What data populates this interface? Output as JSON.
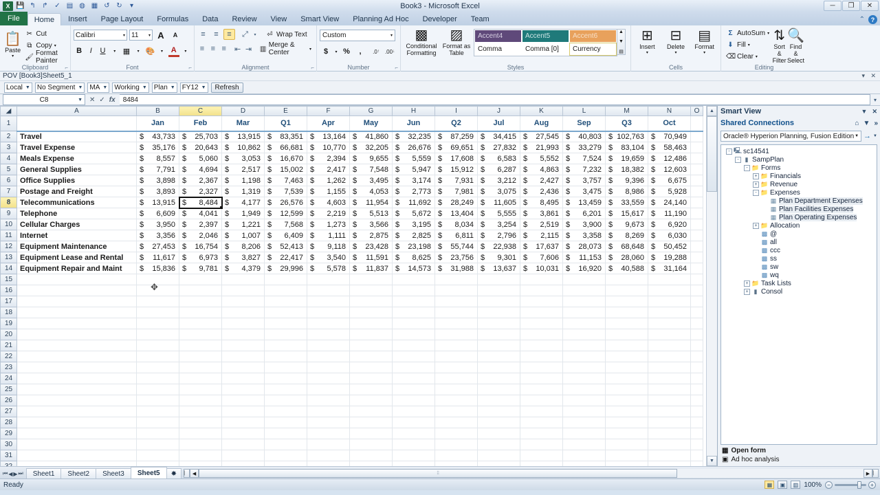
{
  "window": {
    "title": "Book3 - Microsoft Excel",
    "qat": [
      "save-icon",
      "undo-icon",
      "redo-icon",
      "quick-print-icon",
      "new-icon",
      "refresh-icon",
      "sheet-icon",
      "undo2-icon",
      "redo2-icon",
      "customize-icon"
    ],
    "buttons": {
      "minimize": "─",
      "restore": "❐",
      "close": "✕"
    },
    "help": {
      "ribbon_min": "⌃",
      "help": "?"
    }
  },
  "ribbon": {
    "file_tab": "File",
    "tabs": [
      "Home",
      "Insert",
      "Page Layout",
      "Formulas",
      "Data",
      "Review",
      "View",
      "Smart View",
      "Planning Ad Hoc",
      "Developer",
      "Team"
    ],
    "active_tab": "Home",
    "groups": {
      "clipboard": {
        "label": "Clipboard",
        "paste": "Paste",
        "cut": "Cut",
        "copy": "Copy",
        "format_painter": "Format Painter"
      },
      "font": {
        "label": "Font",
        "font_name": "Calibri",
        "font_size": "11",
        "grow": "A",
        "shrink": "A",
        "bold": "B",
        "italic": "I",
        "underline": "U"
      },
      "alignment": {
        "label": "Alignment",
        "wrap_text": "Wrap Text",
        "merge_center": "Merge & Center"
      },
      "number": {
        "label": "Number",
        "format": "Custom",
        "currency": "$",
        "percent": "%",
        "comma": ","
      },
      "styles": {
        "label": "Styles",
        "conditional_formatting": "Conditional Formatting",
        "format_as_table": "Format as Table",
        "gallery": [
          {
            "name": "Accent4",
            "bg": "#5F497A",
            "fg": "#d9d2e4"
          },
          {
            "name": "Accent5",
            "bg": "#1F7A7A",
            "fg": "#cfe6e6"
          },
          {
            "name": "Accent6",
            "bg": "#E8A15C",
            "fg": "#f7e0c8"
          },
          {
            "name": "Comma",
            "bg": "#ffffff",
            "fg": "#1a1a1a"
          },
          {
            "name": "Comma [0]",
            "bg": "#ffffff",
            "fg": "#1a1a1a"
          },
          {
            "name": "Currency",
            "bg": "#ffffff",
            "fg": "#1a1a1a"
          }
        ],
        "selected_style": "Currency"
      },
      "cells": {
        "label": "Cells",
        "insert": "Insert",
        "delete": "Delete",
        "format": "Format"
      },
      "editing": {
        "label": "Editing",
        "autosum": "AutoSum",
        "fill": "Fill",
        "clear": "Clear",
        "sort_filter": "Sort & Filter",
        "find_select": "Find & Select"
      }
    }
  },
  "pov": {
    "title": "POV [Book3]Sheet5_1",
    "selectors": [
      "Local",
      "No Segment",
      "MA",
      "Working",
      "Plan",
      "FY12"
    ],
    "refresh_label": "Refresh"
  },
  "formula_bar": {
    "name_box": "C8",
    "formula": "8484",
    "fx": "fx"
  },
  "grid": {
    "column_headers": [
      "A",
      "B",
      "C",
      "D",
      "E",
      "F",
      "G",
      "H",
      "I",
      "J",
      "K",
      "L",
      "M",
      "N",
      "O"
    ],
    "active_column": "C",
    "active_row": 8,
    "selected_cell": "C8",
    "selected_cell_display": "8,484",
    "month_headers": [
      "",
      "Jan",
      "Feb",
      "Mar",
      "Q1",
      "Apr",
      "May",
      "Jun",
      "Q2",
      "Jul",
      "Aug",
      "Sep",
      "Q3",
      "Oct",
      ""
    ],
    "rows": [
      {
        "n": 2,
        "label": "Travel",
        "values": [
          "43,733",
          "25,703",
          "13,915",
          "83,351",
          "13,164",
          "41,860",
          "32,235",
          "87,259",
          "34,415",
          "27,545",
          "40,803",
          "102,763",
          "70,949",
          ""
        ]
      },
      {
        "n": 3,
        "label": "Travel Expense",
        "values": [
          "35,176",
          "20,643",
          "10,862",
          "66,681",
          "10,770",
          "32,205",
          "26,676",
          "69,651",
          "27,832",
          "21,993",
          "33,279",
          "83,104",
          "58,463",
          ""
        ]
      },
      {
        "n": 4,
        "label": "Meals Expense",
        "values": [
          "8,557",
          "5,060",
          "3,053",
          "16,670",
          "2,394",
          "9,655",
          "5,559",
          "17,608",
          "6,583",
          "5,552",
          "7,524",
          "19,659",
          "12,486",
          ""
        ]
      },
      {
        "n": 5,
        "label": "General Supplies",
        "values": [
          "7,791",
          "4,694",
          "2,517",
          "15,002",
          "2,417",
          "7,548",
          "5,947",
          "15,912",
          "6,287",
          "4,863",
          "7,232",
          "18,382",
          "12,603",
          ""
        ]
      },
      {
        "n": 6,
        "label": "Office Supplies",
        "values": [
          "3,898",
          "2,367",
          "1,198",
          "7,463",
          "1,262",
          "3,495",
          "3,174",
          "7,931",
          "3,212",
          "2,427",
          "3,757",
          "9,396",
          "6,675",
          ""
        ]
      },
      {
        "n": 7,
        "label": "Postage and Freight",
        "values": [
          "3,893",
          "2,327",
          "1,319",
          "7,539",
          "1,155",
          "4,053",
          "2,773",
          "7,981",
          "3,075",
          "2,436",
          "3,475",
          "8,986",
          "5,928",
          ""
        ]
      },
      {
        "n": 8,
        "label": "Telecommunications",
        "values": [
          "13,915",
          "8,484",
          "4,177",
          "26,576",
          "4,603",
          "11,954",
          "11,692",
          "28,249",
          "11,605",
          "8,495",
          "13,459",
          "33,559",
          "24,140",
          ""
        ]
      },
      {
        "n": 9,
        "label": "Telephone",
        "values": [
          "6,609",
          "4,041",
          "1,949",
          "12,599",
          "2,219",
          "5,513",
          "5,672",
          "13,404",
          "5,555",
          "3,861",
          "6,201",
          "15,617",
          "11,190",
          ""
        ]
      },
      {
        "n": 10,
        "label": "Cellular Charges",
        "values": [
          "3,950",
          "2,397",
          "1,221",
          "7,568",
          "1,273",
          "3,566",
          "3,195",
          "8,034",
          "3,254",
          "2,519",
          "3,900",
          "9,673",
          "6,920",
          ""
        ]
      },
      {
        "n": 11,
        "label": "Internet",
        "values": [
          "3,356",
          "2,046",
          "1,007",
          "6,409",
          "1,111",
          "2,875",
          "2,825",
          "6,811",
          "2,796",
          "2,115",
          "3,358",
          "8,269",
          "6,030",
          ""
        ]
      },
      {
        "n": 12,
        "label": "Equipment Maintenance",
        "values": [
          "27,453",
          "16,754",
          "8,206",
          "52,413",
          "9,118",
          "23,428",
          "23,198",
          "55,744",
          "22,938",
          "17,637",
          "28,073",
          "68,648",
          "50,452",
          ""
        ]
      },
      {
        "n": 13,
        "label": "Equipment Lease and Rental",
        "values": [
          "11,617",
          "6,973",
          "3,827",
          "22,417",
          "3,540",
          "11,591",
          "8,625",
          "23,756",
          "9,301",
          "7,606",
          "11,153",
          "28,060",
          "19,288",
          ""
        ]
      },
      {
        "n": 14,
        "label": "Equipment Repair and Maint",
        "values": [
          "15,836",
          "9,781",
          "4,379",
          "29,996",
          "5,578",
          "11,837",
          "14,573",
          "31,988",
          "13,637",
          "10,031",
          "16,920",
          "40,588",
          "31,164",
          ""
        ]
      }
    ],
    "empty_rows": [
      15,
      16,
      17,
      18,
      19,
      20,
      21,
      22,
      23,
      24,
      25,
      26,
      27,
      28,
      29,
      30,
      31,
      32,
      33
    ],
    "currency_symbol": "$"
  },
  "smart_view": {
    "title": "Smart View",
    "panel_controls": {
      "menu": "▼",
      "close": "✕"
    },
    "section": "Shared Connections",
    "section_controls": {
      "home": "home-icon",
      "menu": "▼",
      "more": "»"
    },
    "connection": "Oracle® Hyperion Planning, Fusion Edition",
    "connection_go": "→",
    "connection_menu": "▼",
    "tree": [
      {
        "label": "sc14541",
        "depth": 0,
        "expander": "-",
        "icon": "server-icon",
        "selected": false
      },
      {
        "label": "SampPlan",
        "depth": 1,
        "expander": "-",
        "icon": "database-icon",
        "selected": false
      },
      {
        "label": "Forms",
        "depth": 2,
        "expander": "-",
        "icon": "folder-icon",
        "selected": false
      },
      {
        "label": "Financials",
        "depth": 3,
        "expander": "+",
        "icon": "folder-icon",
        "selected": false
      },
      {
        "label": "Revenue",
        "depth": 3,
        "expander": "+",
        "icon": "folder-icon",
        "selected": false
      },
      {
        "label": "Expenses",
        "depth": 3,
        "expander": "-",
        "icon": "folder-icon",
        "selected": false
      },
      {
        "label": "Plan Department Expenses",
        "depth": 4,
        "expander": "",
        "icon": "form-icon",
        "selected": true
      },
      {
        "label": "Plan Facilities Expenses",
        "depth": 4,
        "expander": "",
        "icon": "form-icon",
        "selected": true
      },
      {
        "label": "Plan Operating Expenses",
        "depth": 4,
        "expander": "",
        "icon": "form-icon",
        "selected": true
      },
      {
        "label": "Allocation",
        "depth": 3,
        "expander": "+",
        "icon": "folder-icon",
        "selected": false
      },
      {
        "label": "@",
        "depth": 3,
        "expander": "",
        "icon": "cube-icon",
        "selected": false
      },
      {
        "label": "all",
        "depth": 3,
        "expander": "",
        "icon": "cube-icon",
        "selected": false
      },
      {
        "label": "ccc",
        "depth": 3,
        "expander": "",
        "icon": "cube-icon",
        "selected": false
      },
      {
        "label": "ss",
        "depth": 3,
        "expander": "",
        "icon": "cube-icon",
        "selected": false
      },
      {
        "label": "sw",
        "depth": 3,
        "expander": "",
        "icon": "cube-icon",
        "selected": false
      },
      {
        "label": "wq",
        "depth": 3,
        "expander": "",
        "icon": "cube-icon",
        "selected": false
      },
      {
        "label": "Task Lists",
        "depth": 2,
        "expander": "+",
        "icon": "folder-icon",
        "selected": false
      },
      {
        "label": "Consol",
        "depth": 2,
        "expander": "+",
        "icon": "database-icon",
        "selected": false
      }
    ],
    "actions": [
      {
        "label": "Open form",
        "icon": "form-icon",
        "bold": true
      },
      {
        "label": "Ad hoc analysis",
        "icon": "adhoc-icon",
        "bold": false
      }
    ]
  },
  "sheet_tabs": {
    "tabs": [
      "Sheet1",
      "Sheet2",
      "Sheet3",
      "Sheet5"
    ],
    "active": "Sheet5",
    "new_sheet_label": "➕",
    "nav": [
      "⏮",
      "◀",
      "▶",
      "⏭"
    ]
  },
  "status_bar": {
    "status": "Ready",
    "view_buttons": [
      "normal-view-icon",
      "page-layout-icon",
      "page-break-icon"
    ],
    "active_view": "normal-view-icon",
    "zoom": "100%",
    "zoom_out": "−",
    "zoom_in": "+"
  }
}
